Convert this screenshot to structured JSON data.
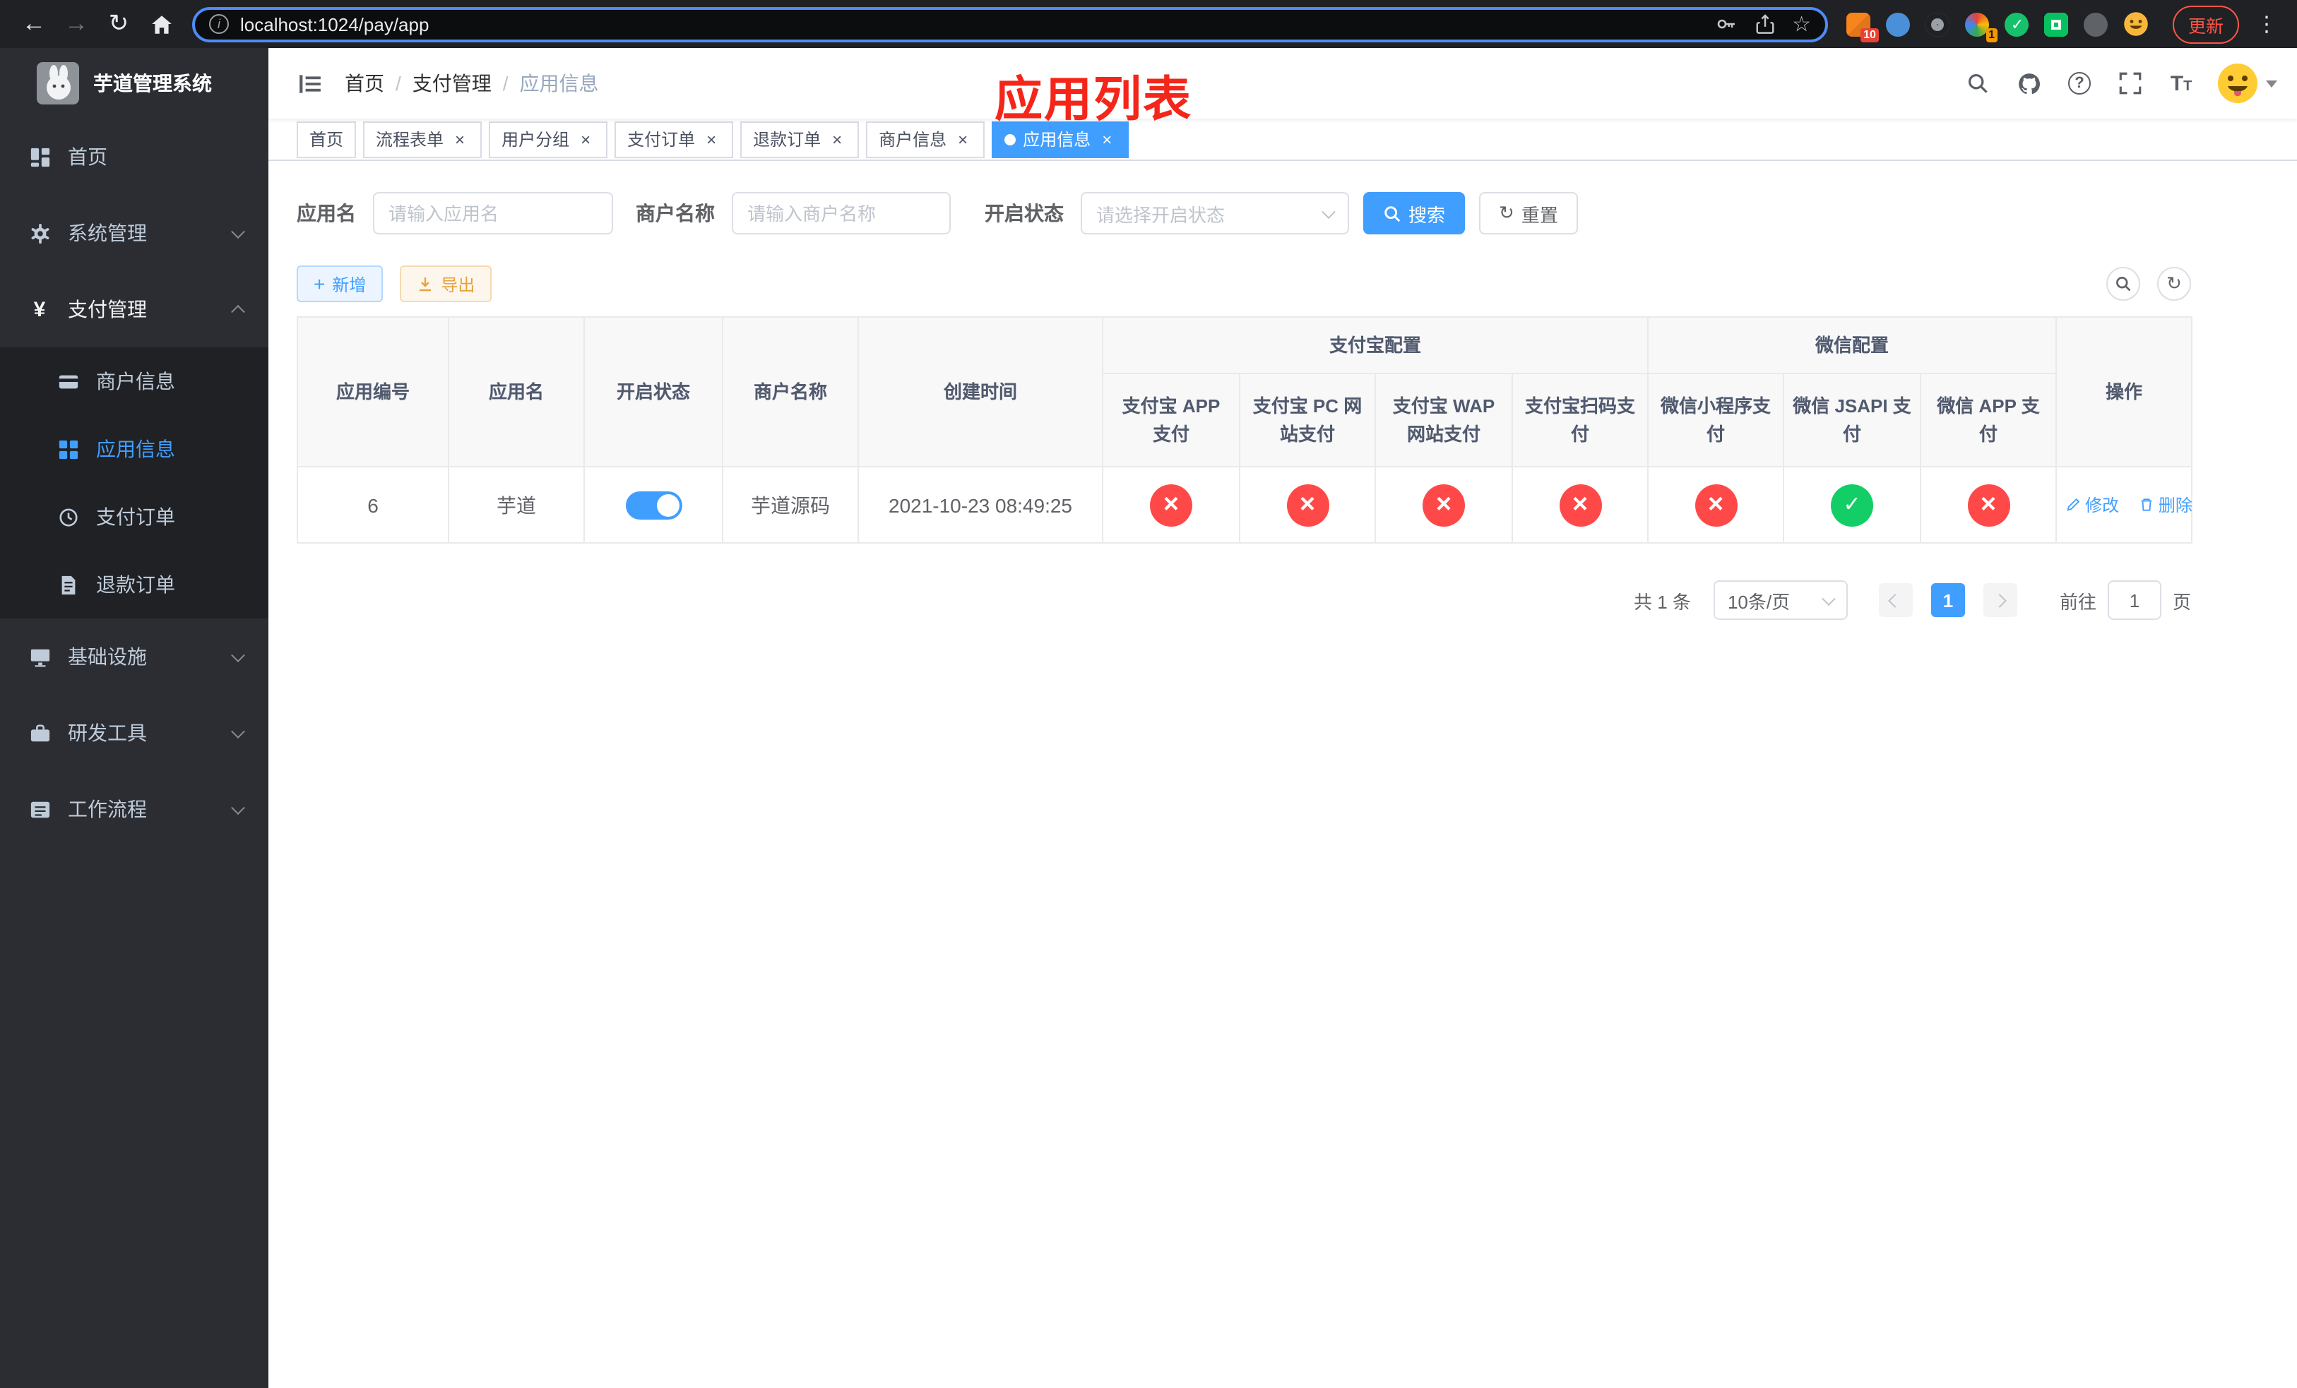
{
  "colors": {
    "accent": "#409eff",
    "page_title_red": "#f4261a",
    "status_on_green": "#13ce66",
    "status_off_red": "#ff4949",
    "warning_orange": "#e6a23c",
    "sidebar_bg": "#2b2d33",
    "submenu_bg": "#1f2125"
  },
  "browser": {
    "url": "localhost:1024/pay/app",
    "update_label": "更新",
    "extension_badges": {
      "grid": "10",
      "avatar": "1"
    }
  },
  "sidebar": {
    "logo_title": "芋道管理系统",
    "items": [
      {
        "label": "首页"
      },
      {
        "label": "系统管理"
      },
      {
        "label": "支付管理"
      },
      {
        "label": "基础设施"
      },
      {
        "label": "研发工具"
      },
      {
        "label": "工作流程"
      }
    ],
    "submenu": [
      {
        "label": "商户信息"
      },
      {
        "label": "应用信息"
      },
      {
        "label": "支付订单"
      },
      {
        "label": "退款订单"
      }
    ]
  },
  "navbar": {
    "breadcrumb": [
      {
        "label": "首页"
      },
      {
        "label": "支付管理"
      },
      {
        "label": "应用信息"
      }
    ],
    "page_title": "应用列表"
  },
  "tabs": [
    {
      "label": "首页"
    },
    {
      "label": "流程表单"
    },
    {
      "label": "用户分组"
    },
    {
      "label": "支付订单"
    },
    {
      "label": "退款订单"
    },
    {
      "label": "商户信息"
    },
    {
      "label": "应用信息"
    }
  ],
  "filters": {
    "app_name": {
      "label": "应用名",
      "placeholder": "请输入应用名"
    },
    "merchant_name": {
      "label": "商户名称",
      "placeholder": "请输入商户名称"
    },
    "status": {
      "label": "开启状态",
      "placeholder": "请选择开启状态"
    },
    "search_label": "搜索",
    "reset_label": "重置"
  },
  "toolbar": {
    "add_label": "新增",
    "export_label": "导出"
  },
  "table": {
    "groups": {
      "alipay": "支付宝配置",
      "wechat": "微信配置"
    },
    "columns": {
      "id": "应用编号",
      "name": "应用名",
      "status": "开启状态",
      "merchant": "商户名称",
      "created": "创建时间",
      "actions": "操作"
    },
    "channel_columns": [
      "支付宝 APP 支付",
      "支付宝 PC 网站支付",
      "支付宝 WAP 网站支付",
      "支付宝扫码支付",
      "微信小程序支付",
      "微信 JSAPI 支付",
      "微信 APP 支付"
    ],
    "rows": [
      {
        "id": "6",
        "name": "芋道",
        "enabled": "on",
        "merchant": "芋道源码",
        "created": "2021-10-23 08:49:25",
        "channels": [
          "no",
          "no",
          "no",
          "no",
          "no",
          "yes",
          "no"
        ],
        "edit_label": "修改",
        "delete_label": "删除"
      }
    ]
  },
  "pagination": {
    "total": "共 1 条",
    "page_size": "10条/页",
    "current_page": "1",
    "goto_label": "前往",
    "goto_value": "1",
    "page_unit": "页"
  }
}
